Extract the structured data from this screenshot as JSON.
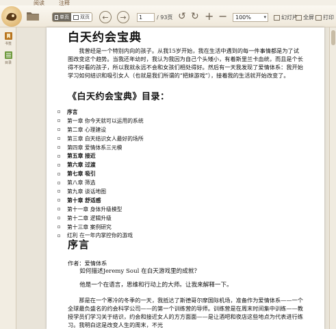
{
  "tabs": [
    "阅读",
    "注释"
  ],
  "toolbar": {
    "view_single": "单页",
    "view_double": "双页",
    "page_current": "1",
    "page_total": "/ 93页",
    "zoom": "100%",
    "slideshow": "幻灯片",
    "fullscreen": "全屏",
    "print": "打印"
  },
  "sidebar": {
    "items": [
      {
        "label": "书签",
        "icon": "bookmark-icon"
      },
      {
        "label": "目录",
        "icon": "toc-icon"
      }
    ]
  },
  "document": {
    "title": "白天约会宝典",
    "intro": "我曾经是一个特别内向的孩子。从我15岁开始，我在生活中遇到的每一件事情都是为了试图改变这个趋势。当我还年幼时，我认为我因为自己个头矮小，有着斯里兰卡血统，而且是个长得不好看的孩子，所以我就永远不会和女孩们相处得好。然后有一天我发现了爱情体系：我开始学习如何结识和吸引女人（也就是我们所谓的“把妹游戏”），接着我的生活就开始改变了。",
    "toc_heading": "《白天约会宝典》目录：",
    "toc": [
      {
        "text": "序言",
        "bold": true
      },
      {
        "text": "第一章  你今天就可以运用的系统",
        "bold": false
      },
      {
        "text": "第二章  心理建设",
        "bold": false
      },
      {
        "text": "第三章  白天结识女人最好的场所",
        "bold": false
      },
      {
        "text": "第四章  爱情体系三元模",
        "bold": false
      },
      {
        "text": "第五章 接近",
        "bold": true
      },
      {
        "text": "第六章 过渡",
        "bold": true
      },
      {
        "text": "第七章 吸引",
        "bold": true
      },
      {
        "text": "第八章  筛选",
        "bold": false
      },
      {
        "text": "第九章  谈话地图",
        "bold": false
      },
      {
        "text": "第十章 舒适感",
        "bold": true
      },
      {
        "text": "第十一章  身体升级模型",
        "bold": false
      },
      {
        "text": "第十二章  逻辑升级",
        "bold": false
      },
      {
        "text": "第十三章  案例研究",
        "bold": false
      },
      {
        "text": "红利  在一年内掌控你的游戏",
        "bold": false
      }
    ],
    "preface_title": "序言",
    "author_line": "作者：爱情体系",
    "p1": "如何描述Jeremy Soul 在白天游戏里的成就？",
    "p2": "他是一个在语言，思维和行动上的大师。让我来解释一下。",
    "p3": "那是在一个寒冷的冬季的一天，我抵达了斯德哥尔摩国际机场，准备作为爱情体系——一个全球最负盛名的约会科学公司——的第一个训练营的导师。训练营是在周末时间集中训练——教授学员们学习关于结识，约会和接近女人的方方面面——是让酒吧和夜店这些地点为代表进行练习。我明白这是改变人生的周末，不光"
  }
}
